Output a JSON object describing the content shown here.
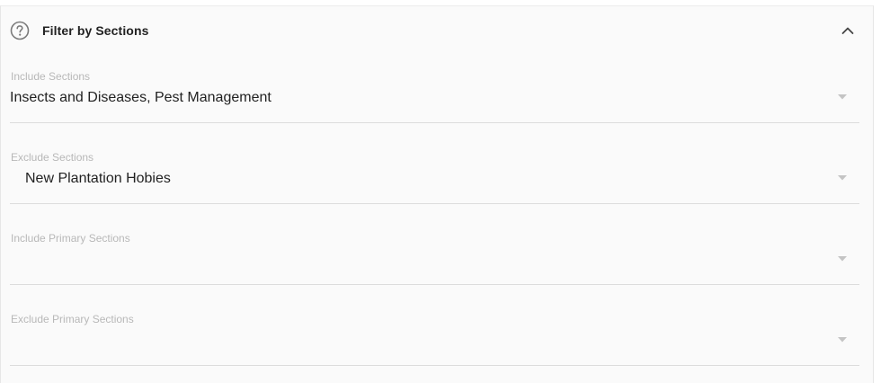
{
  "panel": {
    "title": "Filter by Sections",
    "help_icon": "help-circle-icon",
    "collapse_icon": "chevron-up-icon"
  },
  "fields": {
    "include_sections": {
      "label": "Include Sections",
      "value": "Insects and Diseases, Pest Management"
    },
    "exclude_sections": {
      "label": "Exclude Sections",
      "value": "New Plantation Hobies"
    },
    "include_primary_sections": {
      "label": "Include Primary Sections",
      "value": ""
    },
    "exclude_primary_sections": {
      "label": "Exclude Primary Sections",
      "value": ""
    }
  },
  "colors": {
    "label": "#b8b8b8",
    "text": "#222222",
    "divider": "#dcdcdc",
    "caret": "#c4c4c4"
  }
}
